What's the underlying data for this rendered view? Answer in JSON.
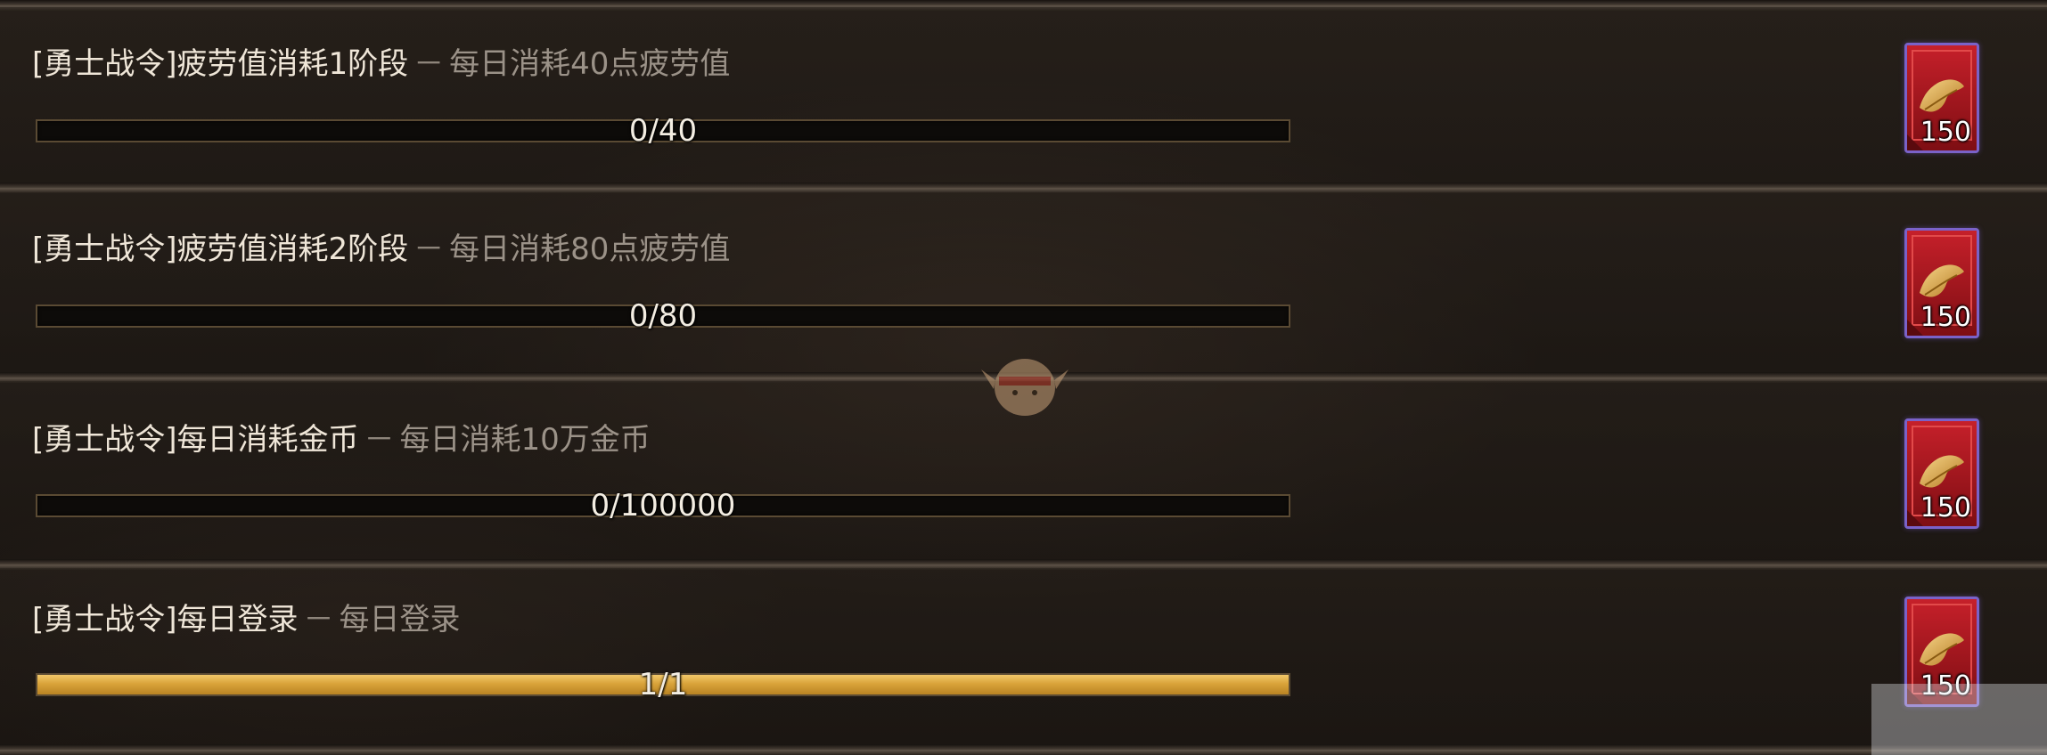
{
  "colors": {
    "background": "#1d1814",
    "title_text": "#efe6d8",
    "description_text": "#9b9288",
    "progress_border": "#5a4a33",
    "progress_fill": "#d9a33a",
    "reward_border": "#7a62c8",
    "reward_background": "#a3151c"
  },
  "quests": [
    {
      "title": "[勇士战令]疲劳值消耗1阶段",
      "separator": "－",
      "description": "每日消耗40点疲劳值",
      "progress_text": "0/40",
      "progress_fraction": 0,
      "reward": {
        "icon": "red-banner-reward-icon",
        "count": "150"
      }
    },
    {
      "title": "[勇士战令]疲劳值消耗2阶段",
      "separator": "－",
      "description": "每日消耗80点疲劳值",
      "progress_text": "0/80",
      "progress_fraction": 0,
      "reward": {
        "icon": "red-banner-reward-icon",
        "count": "150"
      }
    },
    {
      "title": "[勇士战令]每日消耗金币",
      "separator": "－",
      "description": "每日消耗10万金币",
      "progress_text": "0/100000",
      "progress_fraction": 0,
      "reward": {
        "icon": "red-banner-reward-icon",
        "count": "150"
      }
    },
    {
      "title": "[勇士战令]每日登录",
      "separator": "－",
      "description": "每日登录",
      "progress_text": "1/1",
      "progress_fraction": 1,
      "reward": {
        "icon": "red-banner-reward-icon",
        "count": "150"
      }
    }
  ],
  "overlays": {
    "mascot_icon": "mascot-watermark-icon",
    "corner_icon": "corner-watermark-icon"
  }
}
